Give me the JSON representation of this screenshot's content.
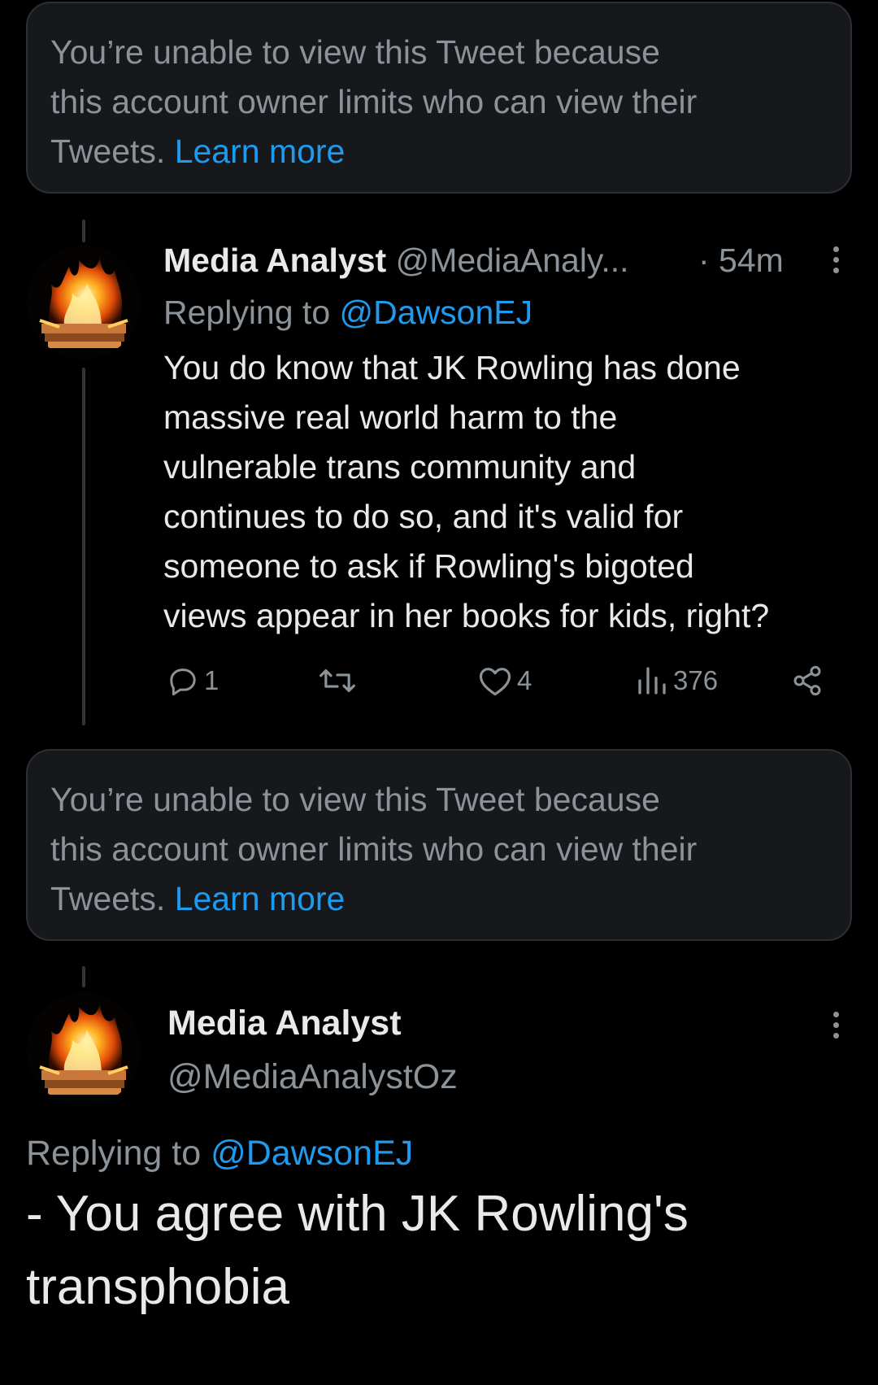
{
  "notices": [
    {
      "lines": [
        "You’re unable to view this Tweet because",
        "this account owner limits who can view their"
      ],
      "tail": "Tweets.",
      "link": "Learn more"
    },
    {
      "lines": [
        "You’re unable to view this Tweet because",
        "this account owner limits who can view their"
      ],
      "tail": "Tweets.",
      "link": "Learn more"
    }
  ],
  "tweet1": {
    "author_name": "Media Analyst",
    "author_handle": "@MediaAnaly...",
    "time": "· 54m",
    "replying_prefix": "Replying to",
    "replying_to": "@DawsonEJ",
    "body_lines": [
      "You do know that JK Rowling has done",
      "massive real world harm to the",
      "vulnerable trans community and",
      "continues to do so, and it's valid for",
      "someone to ask if Rowling's bigoted",
      "views appear in her books for kids, right?"
    ],
    "actions": {
      "reply_icon": "reply-icon",
      "reply_count": "1",
      "retweet_icon": "retweet-icon",
      "like_icon": "heart-icon",
      "like_count": "4",
      "views_icon": "views-icon",
      "views_count": "376",
      "share_icon": "share-icon"
    }
  },
  "tweet2": {
    "author_name": "Media Analyst",
    "author_handle": "@MediaAnalystOz",
    "replying_prefix": "Replying to",
    "replying_to": "@DawsonEJ",
    "body_lines": [
      "- You agree with JK Rowling's",
      "transphobia"
    ]
  },
  "colors": {
    "background": "#000000",
    "notice_bg": "#16181c",
    "link": "#1d9bf0",
    "muted": "#8b9298",
    "text": "#e7e9ea"
  }
}
